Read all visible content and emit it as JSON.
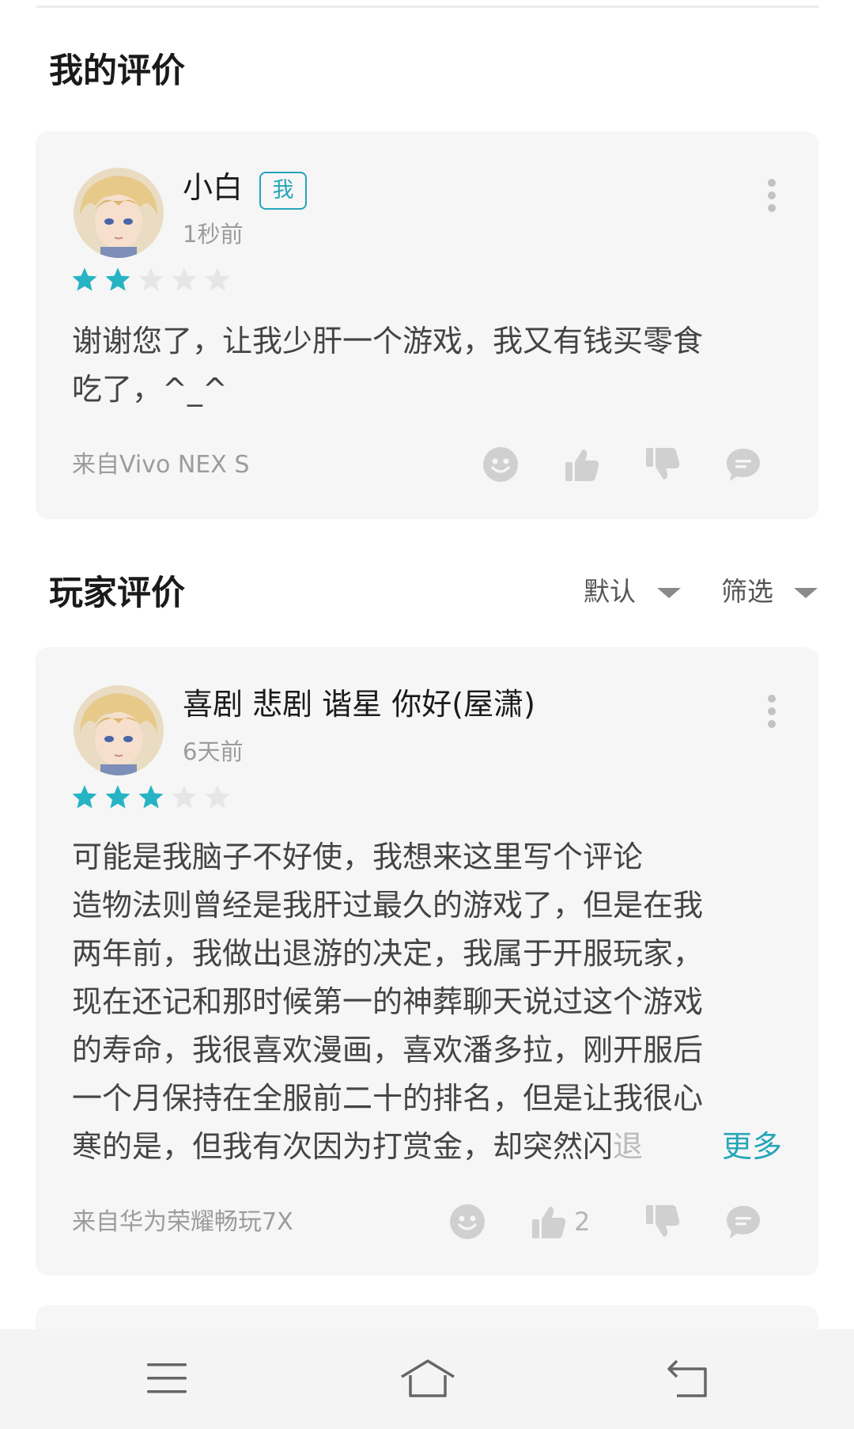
{
  "my_review_section": {
    "title": "我的评价"
  },
  "my_review": {
    "username": "小白",
    "badge": "我",
    "time": "1秒前",
    "rating": 2,
    "max_rating": 5,
    "content_lines": [
      "谢谢您了，让我少肝一个游戏，我又有钱买零食",
      "吃了，^_^"
    ],
    "source": "来自Vivo NEX S"
  },
  "player_reviews_section": {
    "title": "玩家评价",
    "sort_label": "默认",
    "filter_label": "筛选"
  },
  "player_reviews": [
    {
      "username": "喜剧 悲剧 谐星 你好(屋潇)",
      "time": "6天前",
      "rating": 3,
      "max_rating": 5,
      "content_lines": [
        "可能是我脑子不好使，我想来这里写个评论",
        "造物法则曾经是我肝过最久的游戏了，但是在我",
        "两年前，我做出退游的决定，我属于开服玩家，",
        "现在还记和那时候第一的神葬聊天说过这个游戏",
        "的寿命，我很喜欢漫画，喜欢潘多拉，刚开服后",
        "一个月保持在全服前二十的排名，但是让我很心"
      ],
      "last_line_text": "寒的是，但我有次因为打赏金，却突然闪",
      "last_line_fade": "退",
      "more_label": "更多",
      "source": "来自华为荣耀畅玩7X",
      "like_count": "2"
    }
  ],
  "colors": {
    "accent": "#26a6b8",
    "star_on": "#26b4c4",
    "star_off": "#e6e6e6",
    "card_bg": "#f6f6f6",
    "icon": "#d0d0d0"
  },
  "icons": [
    "more-vert-icon",
    "star-icon",
    "emoji-icon",
    "thumbs-up-icon",
    "thumbs-down-icon",
    "comment-icon",
    "dropdown-triangle-icon",
    "menu-icon",
    "home-icon",
    "back-icon"
  ]
}
